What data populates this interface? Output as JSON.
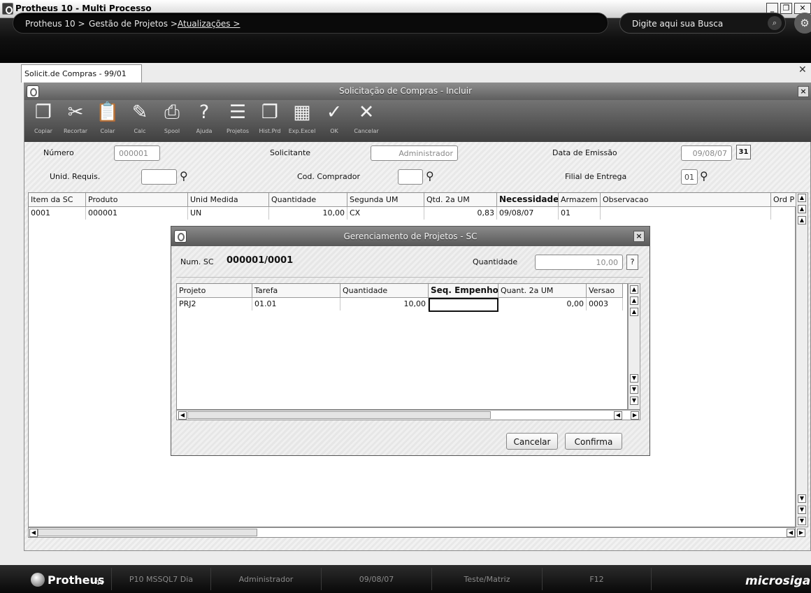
{
  "window": {
    "title": "Protheus 10 - Multi Processo",
    "controls": {
      "minimize": "_",
      "maximize": "❐",
      "close": "✕"
    }
  },
  "nav": {
    "breadcrumb": [
      "Protheus 10 >",
      "Gestão de Projetos >",
      "Atualizações >"
    ],
    "search_placeholder": "Digite aqui sua Busca"
  },
  "tab": {
    "label": "Solicit.de Compras - 99/01",
    "close": "✕"
  },
  "form": {
    "title": "Solicitação de Compras - Incluir",
    "close": "×",
    "toolbar": [
      {
        "label": "Copiar",
        "icon": "copy-icon",
        "glyph": "❐"
      },
      {
        "label": "Recortar",
        "icon": "scissors-icon",
        "glyph": "✂"
      },
      {
        "label": "Colar",
        "icon": "paste-icon",
        "glyph": "📋"
      },
      {
        "label": "Calc",
        "icon": "calculator-icon",
        "glyph": "✎"
      },
      {
        "label": "Spool",
        "icon": "printer-icon",
        "glyph": "⎙"
      },
      {
        "label": "Ajuda",
        "icon": "help-icon",
        "glyph": "?"
      },
      {
        "label": "Projetos",
        "icon": "projects-icon",
        "glyph": "☰"
      },
      {
        "label": "Hist.Prd",
        "icon": "history-icon",
        "glyph": "❐"
      },
      {
        "label": "Exp.Excel",
        "icon": "excel-icon",
        "glyph": "▦"
      },
      {
        "label": "OK",
        "icon": "check-icon",
        "glyph": "✓"
      },
      {
        "label": "Cancelar",
        "icon": "cancel-icon",
        "glyph": "✕"
      }
    ],
    "fields": {
      "numero_label": "Número",
      "numero_value": "000001",
      "solicitante_label": "Solicitante",
      "solicitante_value": "Administrador",
      "data_label": "Data de Emissão",
      "data_value": "09/08/07",
      "calendar_glyph": "31",
      "unid_label": "Unid. Requis.",
      "unid_value": "",
      "comprador_label": "Cod. Comprador",
      "comprador_value": "",
      "filial_label": "Filial de Entrega",
      "filial_value": "01"
    },
    "grid": {
      "columns": [
        "Item da SC",
        "Produto",
        "Unid Medida",
        "Quantidade",
        "Segunda UM",
        "Qtd. 2a UM",
        "Necessidade",
        "Armazem",
        "Observacao",
        "Ord P"
      ],
      "rows": [
        [
          "0001",
          "000001",
          "UN",
          "10,00",
          "CX",
          "0,83",
          "09/08/07",
          "01",
          "",
          ""
        ]
      ]
    }
  },
  "modal": {
    "title": "Gerenciamento de Projetos - SC",
    "close": "×",
    "numsc_label": "Num. SC",
    "numsc_value": "000001/0001",
    "quantidade_label": "Quantidade",
    "quantidade_value": "10,00",
    "help_glyph": "?",
    "grid": {
      "columns": [
        "Projeto",
        "Tarefa",
        "Quantidade",
        "Seq. Empenho",
        "Quant. 2a UM",
        "Versao"
      ],
      "rows": [
        [
          "PRJ2",
          "01.01",
          "10,00",
          "",
          "0,00",
          "0003"
        ]
      ]
    },
    "buttons": {
      "cancel": "Cancelar",
      "confirm": "Confirma"
    }
  },
  "statusbar": {
    "brand": "Protheus",
    "brand_version": "10",
    "items": [
      "P10 MSSQL7 Dia",
      "Administrador",
      "09/08/07",
      "Teste/Matriz",
      "F12"
    ],
    "vendor": "microsiga"
  },
  "colors": {
    "dark_bar": "#0a0a0a",
    "toolbar": "#5a5a5a",
    "grid_border": "#8c8c8c"
  }
}
